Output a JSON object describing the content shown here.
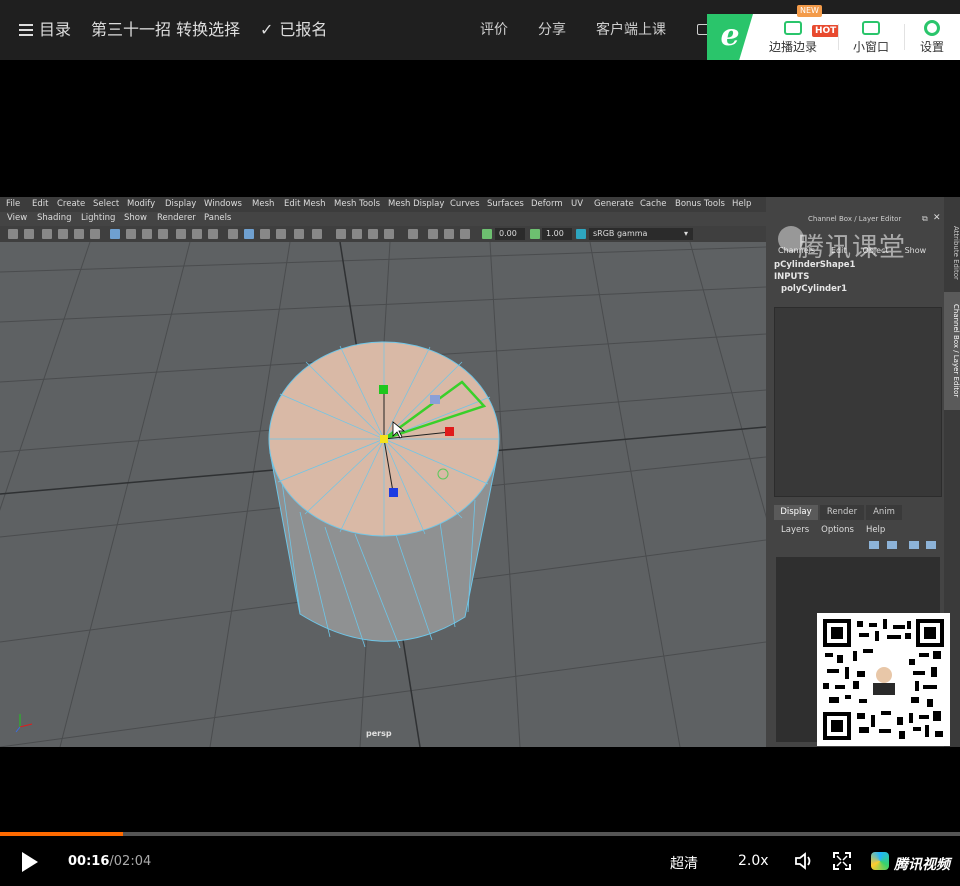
{
  "topbar": {
    "menu_label": "目录",
    "lesson_title": "第三十一招 转换选择",
    "enrolled_label": "已报名",
    "review_label": "评价",
    "share_label": "分享",
    "client_label": "客户端上课"
  },
  "promo": {
    "item1_label": "边播边录",
    "new_badge": "NEW",
    "hot_badge": "HOT",
    "item2_label": "小窗口",
    "item3_label": "设置"
  },
  "maya": {
    "menus": [
      "File",
      "Edit",
      "Create",
      "Select",
      "Modify",
      "Display",
      "Windows",
      "Mesh",
      "Edit Mesh",
      "Mesh Tools",
      "Mesh Display",
      "Curves",
      "Surfaces",
      "Deform",
      "UV",
      "Generate",
      "Cache",
      "Bonus Tools",
      "Help"
    ],
    "panel_menus": [
      "View",
      "Shading",
      "Lighting",
      "Show",
      "Renderer",
      "Panels"
    ],
    "field1": "0.00",
    "field2": "1.00",
    "colorspace": "sRGB gamma",
    "viewport_label": "persp",
    "right_title": "Channel Box / Layer Editor",
    "channel_tabs": [
      "Channels",
      "Edit",
      "Object",
      "Show"
    ],
    "shape_name": "pCylinderShape1",
    "inputs_label": "INPUTS",
    "input_node": "polyCylinder1",
    "layer_tabs": [
      "Display",
      "Render",
      "Anim"
    ],
    "layer_menus": [
      "Layers",
      "Options",
      "Help"
    ],
    "side_tab1": "Attribute Editor",
    "side_tab2": "Channel Box / Layer Editor"
  },
  "watermark": "腾讯课堂",
  "player": {
    "current_time": "00:16",
    "duration": "/02:04",
    "progress_fraction": 0.128,
    "quality": "超清",
    "speed": "2.0x",
    "brand": "腾讯视频"
  },
  "colors": {
    "accent_green": "#2ac56b",
    "progress_orange": "#ff6a00",
    "selection_green": "#39d02a"
  }
}
